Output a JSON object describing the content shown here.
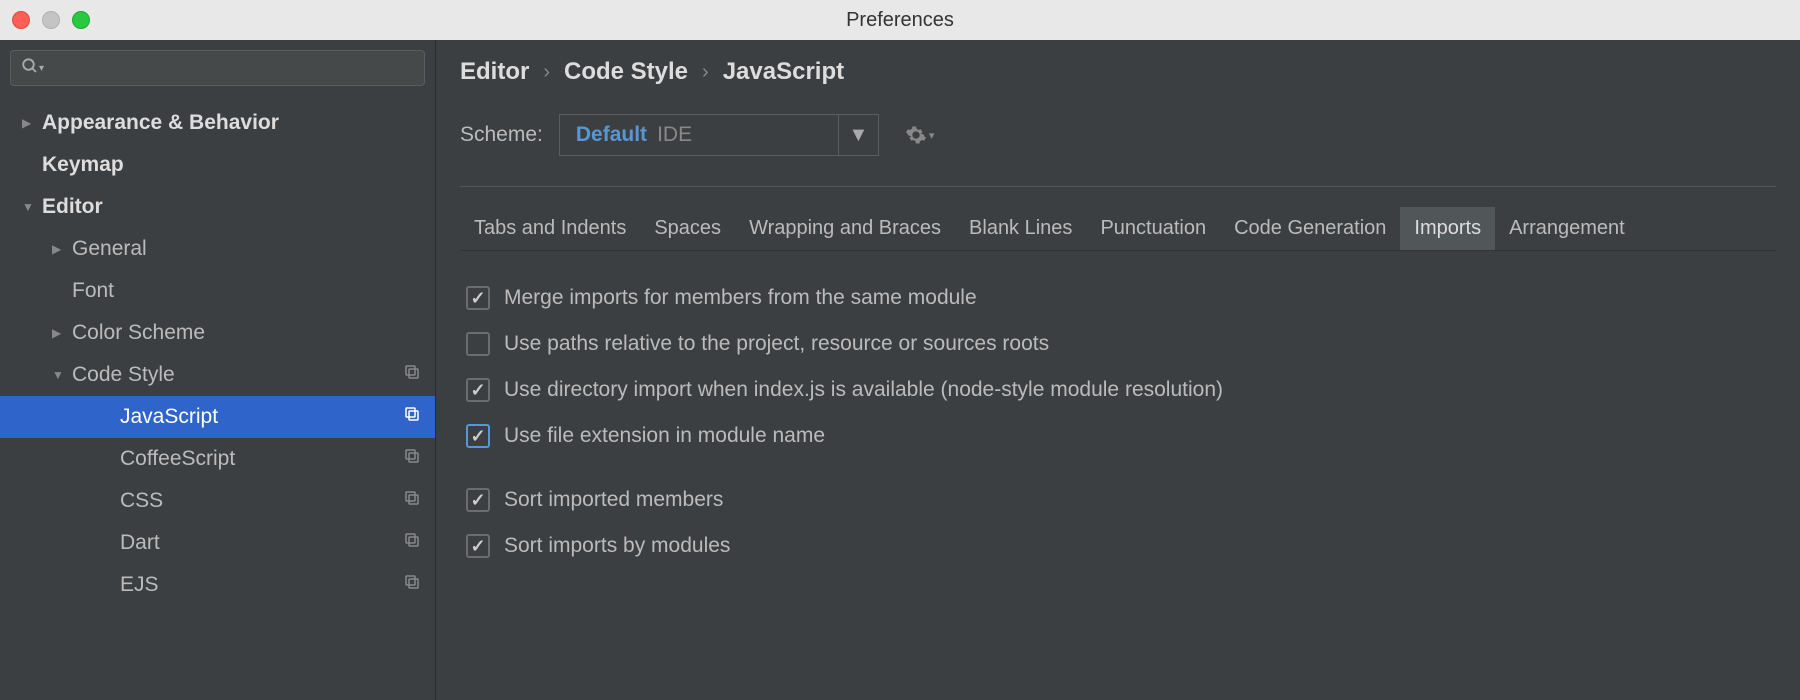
{
  "window": {
    "title": "Preferences"
  },
  "sidebar": {
    "items": [
      {
        "label": "Appearance & Behavior",
        "depth": 0,
        "arrow": "right",
        "bold": true
      },
      {
        "label": "Keymap",
        "depth": 0,
        "arrow": "none",
        "bold": true
      },
      {
        "label": "Editor",
        "depth": 0,
        "arrow": "down",
        "bold": true
      },
      {
        "label": "General",
        "depth": 1,
        "arrow": "right"
      },
      {
        "label": "Font",
        "depth": 1,
        "arrow": "none"
      },
      {
        "label": "Color Scheme",
        "depth": 1,
        "arrow": "right"
      },
      {
        "label": "Code Style",
        "depth": 1,
        "arrow": "down",
        "copy": true
      },
      {
        "label": "JavaScript",
        "depth": 2,
        "arrow": "none",
        "copy": true,
        "selected": true
      },
      {
        "label": "CoffeeScript",
        "depth": 2,
        "arrow": "none",
        "copy": true
      },
      {
        "label": "CSS",
        "depth": 2,
        "arrow": "none",
        "copy": true
      },
      {
        "label": "Dart",
        "depth": 2,
        "arrow": "none",
        "copy": true
      },
      {
        "label": "EJS",
        "depth": 2,
        "arrow": "none",
        "copy": true
      }
    ]
  },
  "breadcrumb": {
    "a": "Editor",
    "b": "Code Style",
    "c": "JavaScript"
  },
  "scheme": {
    "label": "Scheme:",
    "name": "Default",
    "tag": "IDE"
  },
  "tabs": [
    {
      "label": "Tabs and Indents"
    },
    {
      "label": "Spaces"
    },
    {
      "label": "Wrapping and Braces"
    },
    {
      "label": "Blank Lines"
    },
    {
      "label": "Punctuation"
    },
    {
      "label": "Code Generation"
    },
    {
      "label": "Imports",
      "active": true
    },
    {
      "label": "Arrangement"
    }
  ],
  "options": [
    {
      "label": "Merge imports for members from the same module",
      "checked": true
    },
    {
      "label": "Use paths relative to the project, resource or sources roots",
      "checked": false
    },
    {
      "label": "Use directory import when index.js is available (node-style module resolution)",
      "checked": true
    },
    {
      "label": "Use file extension in module name",
      "checked": true,
      "highlighted": true
    },
    {
      "spacer": true
    },
    {
      "label": "Sort imported members",
      "checked": true
    },
    {
      "label": "Sort imports by modules",
      "checked": true
    }
  ]
}
